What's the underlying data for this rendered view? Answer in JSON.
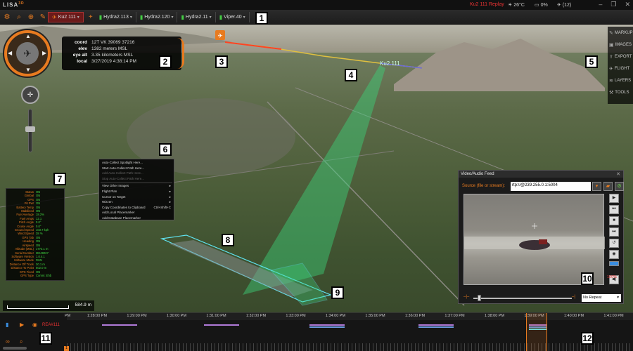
{
  "app": {
    "logo": "LISA",
    "logo_sup": "3D"
  },
  "titlebar": {
    "replay": "Ku2 111 Replay",
    "temp": "26°C",
    "battery": "0%",
    "alerts": "(12)"
  },
  "toolbar": {
    "vehicles": [
      {
        "label": "Ku2 111",
        "active": true
      },
      {
        "label": "Hydra2.113"
      },
      {
        "label": "Hydra2.120"
      },
      {
        "label": "Hydra2.11"
      },
      {
        "label": "Viper.40"
      }
    ]
  },
  "annotations": [
    "1",
    "2",
    "3",
    "4",
    "5",
    "6",
    "7",
    "8",
    "9",
    "10",
    "11",
    "12"
  ],
  "info": [
    {
      "key": "coord",
      "value": "12T VK 39069 37216"
    },
    {
      "key": "elev",
      "value": "1382 meters MSL"
    },
    {
      "key": "eye alt",
      "value": "3.35 kilometers MSL"
    },
    {
      "key": "local",
      "value": "3/27/2019 4:38:14 PM"
    }
  ],
  "map_labels": {
    "aircraft": "Ku2.111"
  },
  "side_menu": [
    "MARKUP",
    "IMAGES",
    "EXPORT",
    "FLIGHT",
    "LAYERS",
    "TOOLS"
  ],
  "context_menu": [
    {
      "label": "Auto-Collect Spotlight Here..."
    },
    {
      "label": "Start Auto-Collect Path Here..."
    },
    {
      "label": "Add Auto-Collect Path Here...",
      "disabled": true
    },
    {
      "label": "Stop Auto-Collect Path Here...",
      "disabled": true
    },
    {
      "sep": true
    },
    {
      "label": "View Other Images",
      "sub": "▸"
    },
    {
      "label": "Flight Plan",
      "sub": "▸"
    },
    {
      "label": "Cursor on Target",
      "sub": "▸"
    },
    {
      "label": "Wizzen",
      "sub": "▸"
    },
    {
      "label": "Copy Coordinates to Clipboard",
      "sub": "Ctrl+Shift+C"
    },
    {
      "label": "Add Local Placemarker"
    },
    {
      "label": "Add Database Placemarker"
    }
  ],
  "telemetry": {
    "rows": [
      {
        "k": "Status",
        "v": "ON"
      },
      {
        "k": "Gimbal",
        "v": "ON"
      },
      {
        "k": "GPS",
        "v": "ON"
      },
      {
        "k": "Pit Pwr",
        "v": "ON"
      },
      {
        "k": "Battery Temp",
        "v": "ON"
      },
      {
        "k": "Stabilized",
        "v": "ON"
      },
      {
        "k": "Fuel Average",
        "v": "18.2%"
      },
      {
        "k": "Fuel Amps",
        "v": "12.1"
      },
      {
        "k": "Pitch Angle",
        "v": "0.0°"
      },
      {
        "k": "Cruise Angle",
        "v": "0.0°"
      },
      {
        "k": "Ground Speed",
        "v": "103.7 kph"
      },
      {
        "k": "Wind Speed",
        "v": "38 %"
      },
      {
        "k": "GPS Tab",
        "v": "ON"
      },
      {
        "k": "Heading",
        "v": "ON"
      },
      {
        "k": "Airspeed",
        "v": "ON"
      },
      {
        "k": "Altitude (MSL)",
        "v": "1772.1 m"
      },
      {
        "k": "Serial Number",
        "v": "MK49027"
      },
      {
        "k": "Software Version",
        "v": "1.0.4.1"
      },
      {
        "k": "Software Mode",
        "v": "RUN"
      },
      {
        "k": "Distance Off Track",
        "v": "30.1 m"
      },
      {
        "k": "Distance To Point",
        "v": "502.0 m"
      },
      {
        "k": "GPS Fixed",
        "v": "ON"
      },
      {
        "k": "GPS Type",
        "v": "Comm: Ehb"
      }
    ]
  },
  "scale": {
    "value": "584.9 m"
  },
  "video": {
    "title": "Video/Audio Feed",
    "source_label": "Source (file or stream):",
    "source_value": "rtp://@239.255.0.1:5004",
    "volume": "100%",
    "repeat": "No Repeat"
  },
  "timeline": {
    "lead": "PM",
    "labels": [
      "1:28:00 PM",
      "1:29:00 PM",
      "1:30:00 PM",
      "1:31:00 PM",
      "1:32:00 PM",
      "1:33:00 PM",
      "1:34:00 PM",
      "1:35:00 PM",
      "1:36:00 PM",
      "1:37:00 PM",
      "1:38:00 PM",
      "1:39:00 PM",
      "1:40:00 PM",
      "1:41:00 PM"
    ],
    "track": "REA#111",
    "rate": "1"
  },
  "colors": {
    "accent": "#e87b20",
    "alert": "#e33333",
    "telemetry_value": "#44dd44",
    "beam": "#3cd27a",
    "footprint": "#5fe3f0"
  }
}
